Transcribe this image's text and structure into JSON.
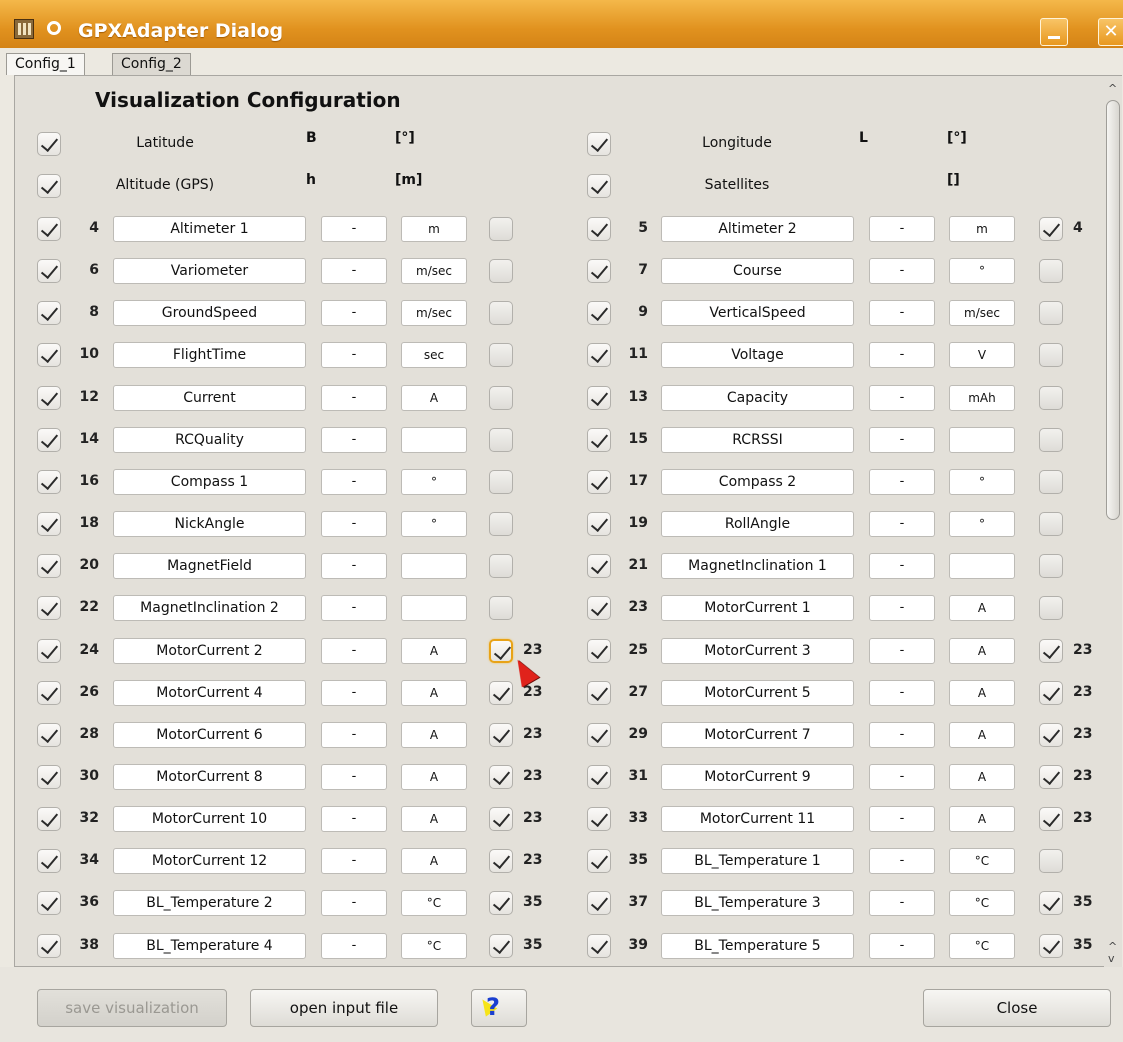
{
  "window": {
    "title": "GPXAdapter Dialog"
  },
  "tabs": [
    {
      "label": "Config_1"
    },
    {
      "label": "Config_2"
    }
  ],
  "section_title": "Visualization Configuration",
  "header_rows": [
    {
      "left": {
        "name": "Latitude",
        "abbrev": "B",
        "unit": "[°]"
      },
      "right": {
        "name": "Longitude",
        "abbrev": "L",
        "unit": "[°]"
      }
    },
    {
      "left": {
        "name": "Altitude (GPS)",
        "abbrev": "h",
        "unit": "[m]"
      },
      "right": {
        "name": "Satellites",
        "abbrev": "",
        "unit": "[]"
      }
    }
  ],
  "rows": [
    {
      "left": {
        "num": "4",
        "name": "Altimeter 1",
        "factor": "-",
        "unit": "m",
        "extra": false,
        "ref": ""
      },
      "right": {
        "num": "5",
        "name": "Altimeter 2",
        "factor": "-",
        "unit": "m",
        "extra": true,
        "ref": "4"
      }
    },
    {
      "left": {
        "num": "6",
        "name": "Variometer",
        "factor": "-",
        "unit": "m/sec",
        "extra": false,
        "ref": ""
      },
      "right": {
        "num": "7",
        "name": "Course",
        "factor": "-",
        "unit": "°",
        "extra": false,
        "ref": ""
      }
    },
    {
      "left": {
        "num": "8",
        "name": "GroundSpeed",
        "factor": "-",
        "unit": "m/sec",
        "extra": false,
        "ref": ""
      },
      "right": {
        "num": "9",
        "name": "VerticalSpeed",
        "factor": "-",
        "unit": "m/sec",
        "extra": false,
        "ref": ""
      }
    },
    {
      "left": {
        "num": "10",
        "name": "FlightTime",
        "factor": "-",
        "unit": "sec",
        "extra": false,
        "ref": ""
      },
      "right": {
        "num": "11",
        "name": "Voltage",
        "factor": "-",
        "unit": "V",
        "extra": false,
        "ref": ""
      }
    },
    {
      "left": {
        "num": "12",
        "name": "Current",
        "factor": "-",
        "unit": "A",
        "extra": false,
        "ref": ""
      },
      "right": {
        "num": "13",
        "name": "Capacity",
        "factor": "-",
        "unit": "mAh",
        "extra": false,
        "ref": ""
      }
    },
    {
      "left": {
        "num": "14",
        "name": "RCQuality",
        "factor": "-",
        "unit": "",
        "extra": false,
        "ref": ""
      },
      "right": {
        "num": "15",
        "name": "RCRSSI",
        "factor": "-",
        "unit": "",
        "extra": false,
        "ref": ""
      }
    },
    {
      "left": {
        "num": "16",
        "name": "Compass 1",
        "factor": "-",
        "unit": "°",
        "extra": false,
        "ref": ""
      },
      "right": {
        "num": "17",
        "name": "Compass 2",
        "factor": "-",
        "unit": "°",
        "extra": false,
        "ref": ""
      }
    },
    {
      "left": {
        "num": "18",
        "name": "NickAngle",
        "factor": "-",
        "unit": "°",
        "extra": false,
        "ref": ""
      },
      "right": {
        "num": "19",
        "name": "RollAngle",
        "factor": "-",
        "unit": "°",
        "extra": false,
        "ref": ""
      }
    },
    {
      "left": {
        "num": "20",
        "name": "MagnetField",
        "factor": "-",
        "unit": "",
        "extra": false,
        "ref": ""
      },
      "right": {
        "num": "21",
        "name": "MagnetInclination 1",
        "factor": "-",
        "unit": "",
        "extra": false,
        "ref": ""
      }
    },
    {
      "left": {
        "num": "22",
        "name": "MagnetInclination 2",
        "factor": "-",
        "unit": "",
        "extra": false,
        "ref": ""
      },
      "right": {
        "num": "23",
        "name": "MotorCurrent 1",
        "factor": "-",
        "unit": "A",
        "extra": false,
        "ref": ""
      }
    },
    {
      "left": {
        "num": "24",
        "name": "MotorCurrent 2",
        "factor": "-",
        "unit": "A",
        "extra": true,
        "ref": "23",
        "focused": true
      },
      "right": {
        "num": "25",
        "name": "MotorCurrent 3",
        "factor": "-",
        "unit": "A",
        "extra": true,
        "ref": "23"
      }
    },
    {
      "left": {
        "num": "26",
        "name": "MotorCurrent 4",
        "factor": "-",
        "unit": "A",
        "extra": true,
        "ref": "23"
      },
      "right": {
        "num": "27",
        "name": "MotorCurrent 5",
        "factor": "-",
        "unit": "A",
        "extra": true,
        "ref": "23"
      }
    },
    {
      "left": {
        "num": "28",
        "name": "MotorCurrent 6",
        "factor": "-",
        "unit": "A",
        "extra": true,
        "ref": "23"
      },
      "right": {
        "num": "29",
        "name": "MotorCurrent 7",
        "factor": "-",
        "unit": "A",
        "extra": true,
        "ref": "23"
      }
    },
    {
      "left": {
        "num": "30",
        "name": "MotorCurrent 8",
        "factor": "-",
        "unit": "A",
        "extra": true,
        "ref": "23"
      },
      "right": {
        "num": "31",
        "name": "MotorCurrent 9",
        "factor": "-",
        "unit": "A",
        "extra": true,
        "ref": "23"
      }
    },
    {
      "left": {
        "num": "32",
        "name": "MotorCurrent 10",
        "factor": "-",
        "unit": "A",
        "extra": true,
        "ref": "23"
      },
      "right": {
        "num": "33",
        "name": "MotorCurrent 11",
        "factor": "-",
        "unit": "A",
        "extra": true,
        "ref": "23"
      }
    },
    {
      "left": {
        "num": "34",
        "name": "MotorCurrent 12",
        "factor": "-",
        "unit": "A",
        "extra": true,
        "ref": "23"
      },
      "right": {
        "num": "35",
        "name": "BL_Temperature 1",
        "factor": "-",
        "unit": "°C",
        "extra": false,
        "ref": ""
      }
    },
    {
      "left": {
        "num": "36",
        "name": "BL_Temperature 2",
        "factor": "-",
        "unit": "°C",
        "extra": true,
        "ref": "35"
      },
      "right": {
        "num": "37",
        "name": "BL_Temperature 3",
        "factor": "-",
        "unit": "°C",
        "extra": true,
        "ref": "35"
      }
    },
    {
      "left": {
        "num": "38",
        "name": "BL_Temperature 4",
        "factor": "-",
        "unit": "°C",
        "extra": true,
        "ref": "35"
      },
      "right": {
        "num": "39",
        "name": "BL_Temperature 5",
        "factor": "-",
        "unit": "°C",
        "extra": true,
        "ref": "35"
      }
    }
  ],
  "buttons": {
    "save": "save visualization",
    "open": "open input file",
    "help_icon": "whats-this-help-icon",
    "close": "Close"
  }
}
